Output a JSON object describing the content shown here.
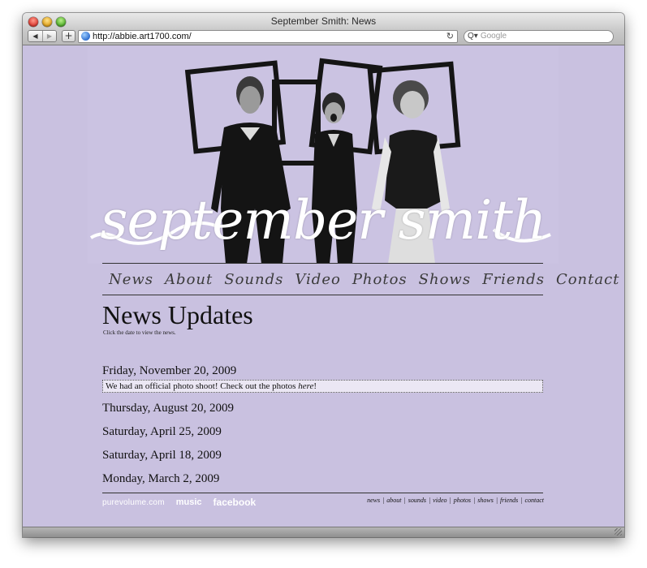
{
  "browser": {
    "window_title": "September Smith: News",
    "url": "http://abbie.art1700.com/",
    "search_placeholder": "Google",
    "back_icon": "◀",
    "forward_icon": "▶",
    "add_icon": "+",
    "reload_icon": "↻",
    "search_icon": "Q▾"
  },
  "header": {
    "logo_text": "september smith"
  },
  "nav": {
    "items": [
      "News",
      "About",
      "Sounds",
      "Video",
      "Photos",
      "Shows",
      "Friends",
      "Contact"
    ]
  },
  "main": {
    "title": "News Updates",
    "subtitle": "Click the date to view the news.",
    "entries": [
      {
        "date": "Friday, November 20, 2009",
        "body_prefix": "We had an official photo shoot! Check out the photos ",
        "body_link": "here",
        "body_suffix": "!"
      },
      {
        "date": "Thursday, August 20, 2009"
      },
      {
        "date": "Saturday, April 25, 2009"
      },
      {
        "date": "Saturday, April 18, 2009"
      },
      {
        "date": "Monday, March 2, 2009"
      }
    ]
  },
  "footer": {
    "badges": [
      "purevolume.com",
      "music",
      "facebook"
    ],
    "nav": [
      "news",
      "about",
      "sounds",
      "video",
      "photos",
      "shows",
      "friends",
      "contact"
    ]
  },
  "colors": {
    "page_bg": "#c9c1e0",
    "text": "#111111"
  }
}
